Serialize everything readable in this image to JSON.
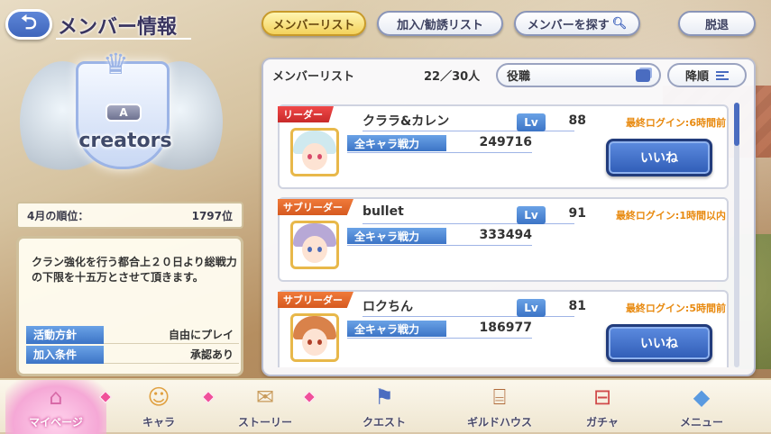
{
  "header": {
    "title": "メンバー情報",
    "tabs": [
      {
        "label": "メンバーリスト",
        "active": true
      },
      {
        "label": "加入/勧誘リスト",
        "active": false
      },
      {
        "label": "メンバーを探す",
        "active": false
      },
      {
        "label": "脱退",
        "active": false
      }
    ]
  },
  "clan": {
    "rank_letter": "A",
    "name": "creators",
    "rank_label": "4月の順位：",
    "rank_value": "1797位",
    "description": "クラン強化を行う都合上２０日より総戦力の下限を十五万とさせて頂きます。",
    "policy_label": "活動方針",
    "policy_value": "自由にプレイ",
    "join_label": "加入条件",
    "join_value": "承認あり"
  },
  "member_list": {
    "title": "メンバーリスト",
    "count": "22／30人",
    "filter_label": "役職",
    "sort_label": "降順",
    "power_label": "全キャラ戦力",
    "lv_label": "Lv",
    "like_label": "いいね",
    "members": [
      {
        "role": "リーダー",
        "name": "クララ&カレン",
        "level": "88",
        "power": "249716",
        "last_login": "最終ログイン:6時間前",
        "has_like": true,
        "hair_color": "#cfe9ef",
        "eye_color": "#d84a6a"
      },
      {
        "role": "サブリーダー",
        "name": "bullet",
        "level": "91",
        "power": "333494",
        "last_login": "最終ログイン:1時間以内",
        "has_like": false,
        "hair_color": "#b7a8d6",
        "eye_color": "#4a6ab8"
      },
      {
        "role": "サブリーダー",
        "name": "ロクちん",
        "level": "81",
        "power": "186977",
        "last_login": "最終ログイン:5時間前",
        "has_like": true,
        "hair_color": "#d9824a",
        "eye_color": "#b0402a"
      }
    ]
  },
  "bottom_nav": [
    {
      "label": "マイページ",
      "icon": "home-icon",
      "active": true,
      "notif": true
    },
    {
      "label": "キャラ",
      "icon": "character-icon",
      "active": false,
      "notif": true
    },
    {
      "label": "ストーリー",
      "icon": "scroll-icon",
      "active": false,
      "notif": true
    },
    {
      "label": "クエスト",
      "icon": "flag-sword-icon",
      "active": false,
      "notif": false
    },
    {
      "label": "ギルドハウス",
      "icon": "door-icon",
      "active": false,
      "notif": false
    },
    {
      "label": "ガチャ",
      "icon": "gacha-icon",
      "active": false,
      "notif": false
    },
    {
      "label": "メニュー",
      "icon": "crystal-icon",
      "active": false,
      "notif": false
    }
  ]
}
